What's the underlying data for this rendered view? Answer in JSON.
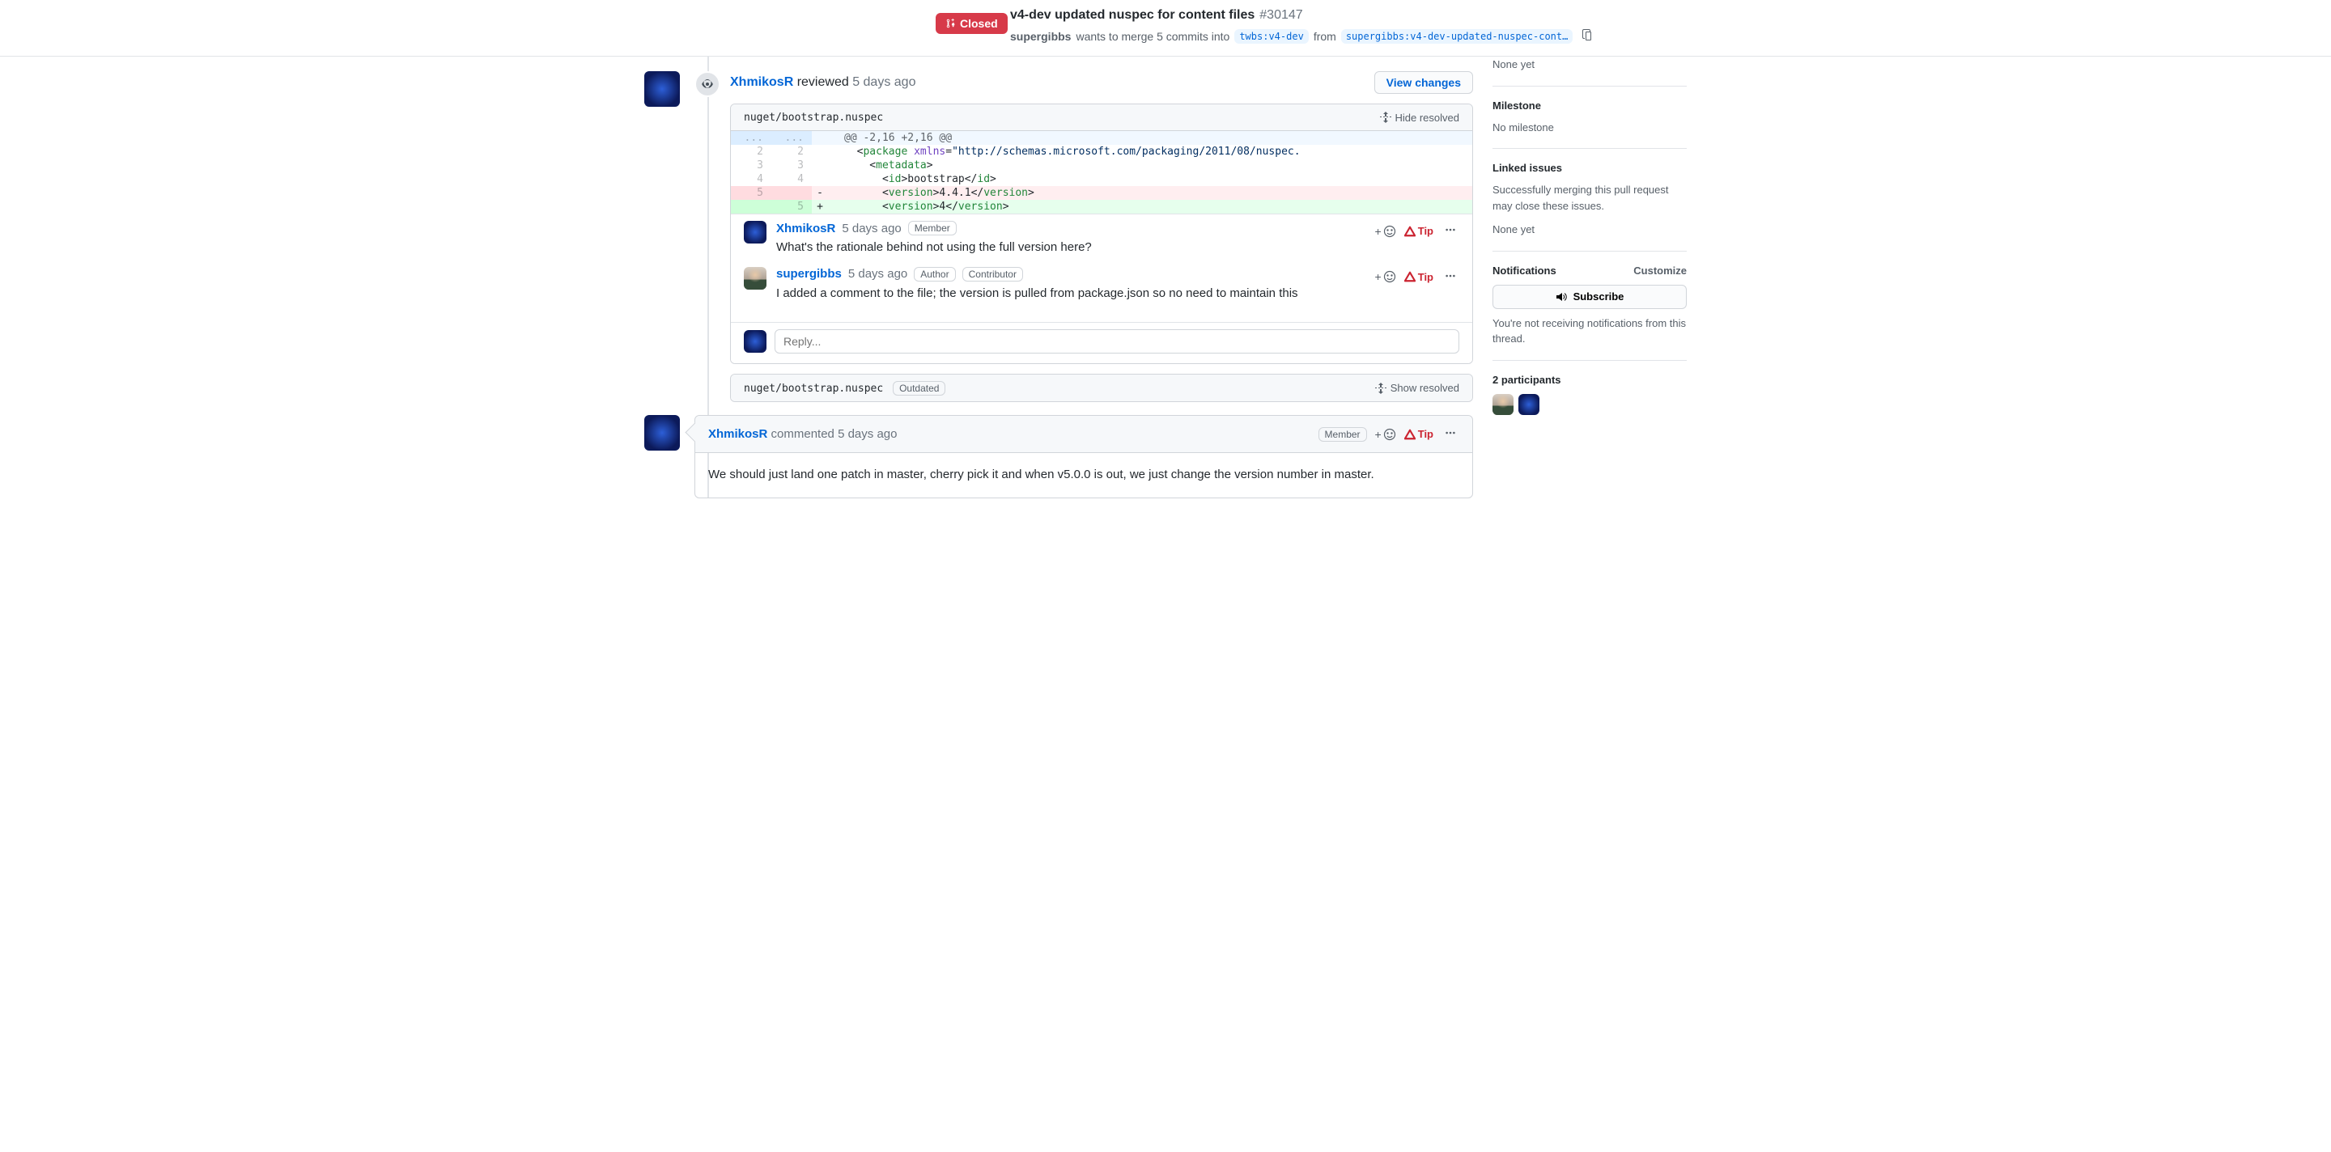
{
  "header": {
    "status": "Closed",
    "title": "v4-dev updated nuspec for content files",
    "number": "#30147",
    "author": "supergibbs",
    "merge_text_1": "wants to merge 5 commits into",
    "base_branch": "twbs:v4-dev",
    "from_text": "from",
    "head_branch": "supergibbs:v4-dev-updated-nuspec-cont…"
  },
  "review": {
    "author": "XhmikosR",
    "action": "reviewed",
    "time": "5 days ago",
    "view_changes": "View changes",
    "file1": {
      "path": "nuget/bootstrap.nuspec",
      "hide_resolved": "Hide resolved",
      "hunk": "@@ -2,16 +2,16 @@",
      "lines": {
        "l2_old": "2",
        "l2_new": "2",
        "l3_old": "3",
        "l3_new": "3",
        "l4_old": "4",
        "l4_new": "4",
        "l5_old": "5",
        "l5_new": "5"
      },
      "code": {
        "package_open": "<",
        "package_tag": "package",
        "xmlns_attr": "xmlns",
        "xmlns_val": "\"http://schemas.microsoft.com/packaging/2011/08/nuspec.",
        "metadata_tag": "metadata",
        "id_tag": "id",
        "id_val": "bootstrap",
        "version_tag": "version",
        "old_version": "4.4.1",
        "new_version": "4"
      },
      "comments": [
        {
          "author": "XhmikosR",
          "time": "5 days ago",
          "roles": [
            "Member"
          ],
          "text": "What's the rationale behind not using the full version here?"
        },
        {
          "author": "supergibbs",
          "time": "5 days ago",
          "roles": [
            "Author",
            "Contributor"
          ],
          "text": "I added a comment to the file; the version is pulled from package.json so no need to maintain this"
        }
      ],
      "reply_placeholder": "Reply..."
    },
    "file2": {
      "path": "nuget/bootstrap.nuspec",
      "outdated": "Outdated",
      "show_resolved": "Show resolved"
    }
  },
  "comment": {
    "author": "XhmikosR",
    "action": "commented",
    "time": "5 days ago",
    "role": "Member",
    "text": "We should just land one patch in master, cherry pick it and when v5.0.0 is out, we just change the version number in master."
  },
  "actions": {
    "reaction_prefix": "+",
    "tip": "Tip"
  },
  "sidebar": {
    "none_yet": "None yet",
    "milestone_title": "Milestone",
    "milestone_text": "No milestone",
    "linked_title": "Linked issues",
    "linked_text": "Successfully merging this pull request may close these issues.",
    "linked_none": "None yet",
    "notif_title": "Notifications",
    "customize": "Customize",
    "subscribe": "Subscribe",
    "notif_text": "You're not receiving notifications from this thread.",
    "participants_title": "2 participants"
  }
}
